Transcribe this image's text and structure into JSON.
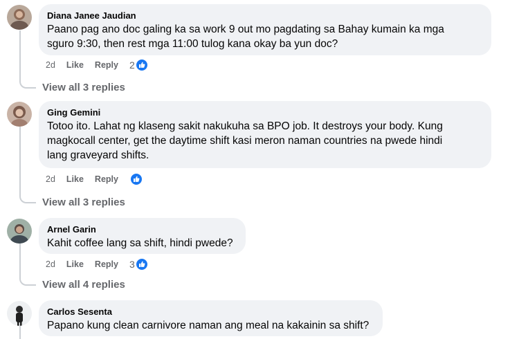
{
  "comments": [
    {
      "author": "Diana Janee Jaudian",
      "lines": [
        "Paano pag ano doc galing ka sa work 9 out mo pagdating sa Bahay kumain ka mga",
        "sguro 9:30, then rest mga 11:00 tulog kana okay ba yun doc?"
      ],
      "time": "2d",
      "like": "Like",
      "reply": "Reply",
      "reactions": "2",
      "replies": "View all 3 replies"
    },
    {
      "author": "Ging Gemini",
      "lines": [
        "Totoo ito. Lahat ng klaseng sakit nakukuha sa BPO job. It destroys your body. Kung",
        "magkocall center, get the daytime shift kasi meron naman countries na pwede hindi",
        "lang graveyard shifts."
      ],
      "time": "2d",
      "like": "Like",
      "reply": "Reply",
      "reactions": "",
      "replies": "View all 3 replies"
    },
    {
      "author": "Arnel Garin",
      "lines": [
        "Kahit coffee lang sa shift, hindi pwede?"
      ],
      "time": "2d",
      "like": "Like",
      "reply": "Reply",
      "reactions": "3",
      "replies": "View all 4 replies"
    },
    {
      "author": "Carlos Sesenta",
      "lines": [
        "Papano kung clean carnivore naman ang meal na kakainin sa shift?"
      ]
    }
  ],
  "colors": {
    "bubble": "#f0f2f5",
    "muted": "#65676b",
    "like_blue": "#1877f2"
  },
  "icons": {
    "reaction": "thumbs-up-icon"
  }
}
